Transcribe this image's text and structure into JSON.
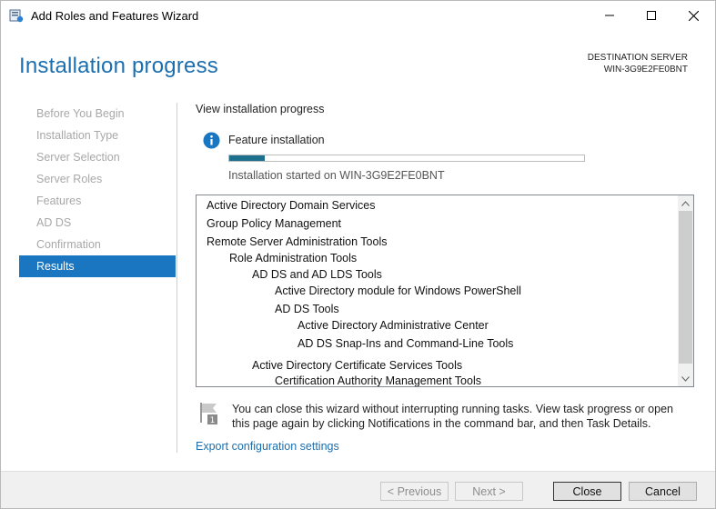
{
  "window": {
    "title": "Add Roles and Features Wizard",
    "icon": "server-manager-icon",
    "controls": [
      "minimize-icon",
      "maximize-icon",
      "close-icon"
    ]
  },
  "header": {
    "page_title": "Installation progress",
    "destination_label": "DESTINATION SERVER",
    "destination_value": "WIN-3G9E2FE0BNT"
  },
  "nav": {
    "items": [
      {
        "label": "Before You Begin",
        "active": false
      },
      {
        "label": "Installation Type",
        "active": false
      },
      {
        "label": "Server Selection",
        "active": false
      },
      {
        "label": "Server Roles",
        "active": false
      },
      {
        "label": "Features",
        "active": false
      },
      {
        "label": "AD DS",
        "active": false
      },
      {
        "label": "Confirmation",
        "active": false
      },
      {
        "label": "Results",
        "active": true
      }
    ]
  },
  "main": {
    "section_label": "View installation progress",
    "feature_label": "Feature installation",
    "progress_fraction": 0.1,
    "started_text": "Installation started on WIN-3G9E2FE0BNT",
    "features": [
      "Active Directory Domain Services",
      "Group Policy Management",
      "Remote Server Administration Tools",
      "Role Administration Tools",
      "AD DS and AD LDS Tools",
      "Active Directory module for Windows PowerShell",
      "AD DS Tools",
      "Active Directory Administrative Center",
      "AD DS Snap-Ins and Command-Line Tools",
      "Active Directory Certificate Services Tools",
      "Certification Authority Management Tools"
    ],
    "note": "You can close this wizard without interrupting running tasks. View task progress or open this page again by clicking Notifications in the command bar, and then Task Details.",
    "export_link": "Export configuration settings"
  },
  "footer": {
    "previous": "< Previous",
    "next": "Next >",
    "close": "Close",
    "cancel": "Cancel"
  },
  "colors": {
    "accent": "#1a76c0",
    "title": "#1b6fb0",
    "progress": "#1d6f8e"
  }
}
